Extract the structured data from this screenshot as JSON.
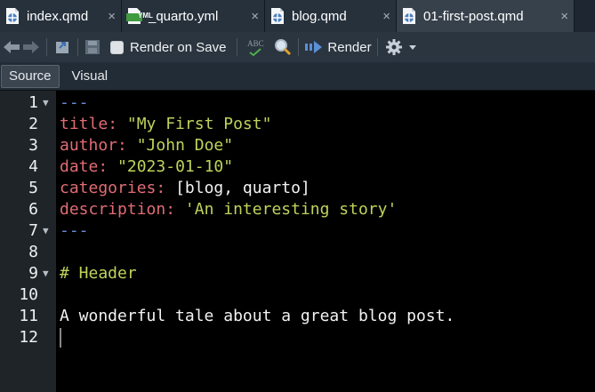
{
  "tabs": [
    {
      "label": "index.qmd",
      "close": "×",
      "icon": "quarto-file-icon"
    },
    {
      "label": "_quarto.yml",
      "close": "×",
      "icon": "yml-file-icon"
    },
    {
      "label": "blog.qmd",
      "close": "×",
      "icon": "quarto-file-icon"
    },
    {
      "label": "01-first-post.qmd",
      "close": "×",
      "icon": "quarto-file-icon"
    }
  ],
  "yml_badge": "YML",
  "toolbar": {
    "render_on_save_label": "Render on Save",
    "render_on_save_checked": false,
    "spellcheck_label": "ABC",
    "render_label": "Render"
  },
  "modes": {
    "source": "Source",
    "visual": "Visual"
  },
  "editor": {
    "line_numbers": [
      "1",
      "2",
      "3",
      "4",
      "5",
      "6",
      "7",
      "8",
      "9",
      "10",
      "11",
      "12"
    ],
    "lines": [
      {
        "seg": [
          "---"
        ]
      },
      {
        "seg": [
          "title",
          ": ",
          "\"My First Post\""
        ]
      },
      {
        "seg": [
          "author",
          ": ",
          "\"John Doe\""
        ]
      },
      {
        "seg": [
          "date",
          ": ",
          "\"2023-01-10\""
        ]
      },
      {
        "seg": [
          "categories",
          ": ",
          "[blog, quarto]"
        ]
      },
      {
        "seg": [
          "description",
          ": ",
          "'An interesting story'"
        ]
      },
      {
        "seg": [
          "---"
        ]
      },
      {
        "seg": [
          ""
        ]
      },
      {
        "seg": [
          "# Header"
        ]
      },
      {
        "seg": [
          ""
        ]
      },
      {
        "seg": [
          "A wonderful tale about a great blog post."
        ]
      },
      {
        "seg": [
          ""
        ]
      }
    ]
  },
  "colors": {
    "yaml_delimiter": "#6f8bd6",
    "yaml_key": "#e06c75",
    "string": "#bdd35a",
    "text": "#f2f2f2"
  }
}
